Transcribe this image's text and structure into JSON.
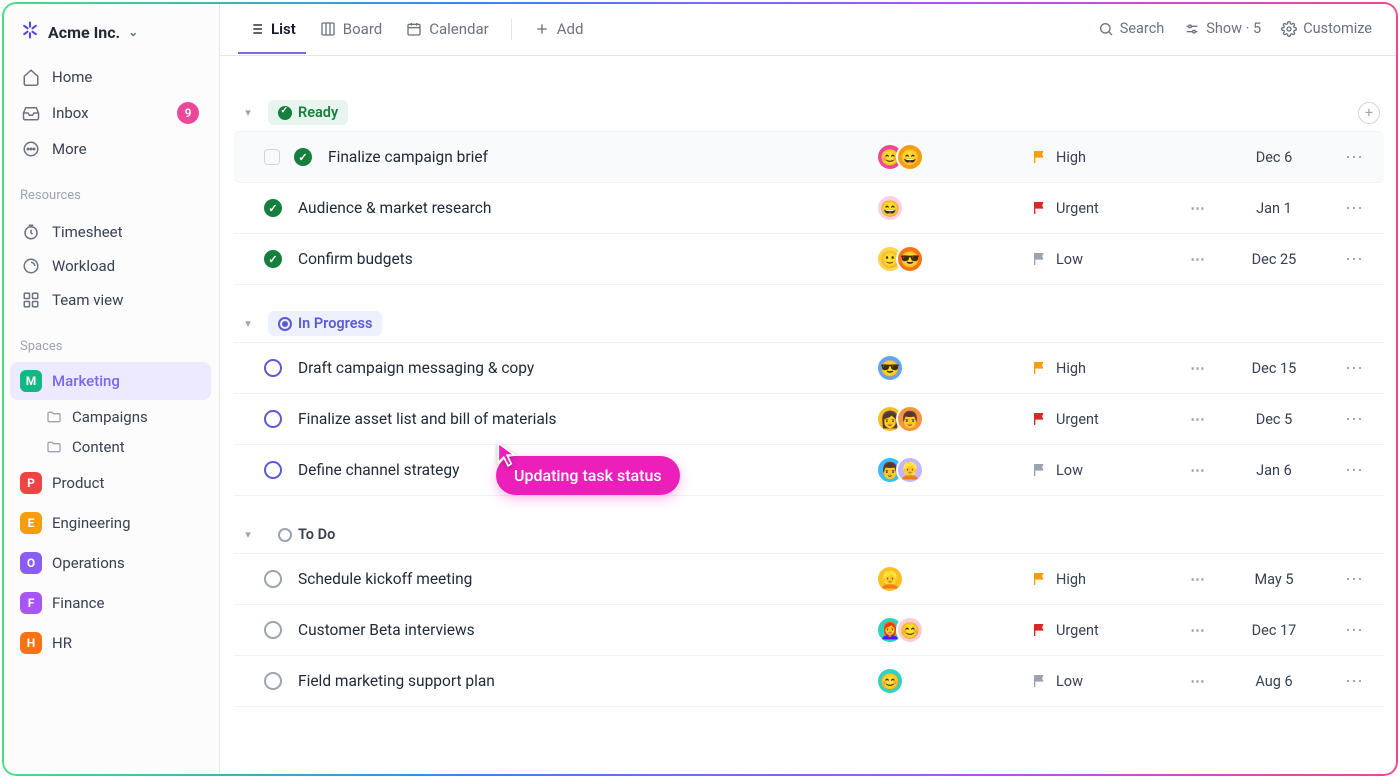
{
  "workspace": {
    "name": "Acme Inc."
  },
  "sidebar": {
    "nav": [
      {
        "label": "Home"
      },
      {
        "label": "Inbox",
        "badge": "9"
      },
      {
        "label": "More"
      }
    ],
    "sections": {
      "resources_label": "Resources",
      "resources": [
        {
          "label": "Timesheet"
        },
        {
          "label": "Workload"
        },
        {
          "label": "Team view"
        }
      ],
      "spaces_label": "Spaces",
      "spaces": [
        {
          "letter": "M",
          "label": "Marketing",
          "color": "#10b981",
          "active": true,
          "children": [
            {
              "label": "Campaigns"
            },
            {
              "label": "Content"
            }
          ]
        },
        {
          "letter": "P",
          "label": "Product",
          "color": "#ef4444"
        },
        {
          "letter": "E",
          "label": "Engineering",
          "color": "#f59e0b"
        },
        {
          "letter": "O",
          "label": "Operations",
          "color": "#8b5cf6"
        },
        {
          "letter": "F",
          "label": "Finance",
          "color": "#a855f7"
        },
        {
          "letter": "H",
          "label": "HR",
          "color": "#f97316"
        }
      ]
    }
  },
  "topbar": {
    "views": [
      {
        "label": "List",
        "active": true
      },
      {
        "label": "Board"
      },
      {
        "label": "Calendar"
      }
    ],
    "add_label": "Add",
    "right": {
      "search": "Search",
      "show": "Show · 5",
      "customize": "Customize"
    }
  },
  "tooltip": "Updating task status",
  "groups": [
    {
      "id": "ready",
      "kind": "ready",
      "label": "Ready",
      "tasks": [
        {
          "name": "Finalize campaign brief",
          "hover": true,
          "checkbox": true,
          "assignees": [
            "#ec4899",
            "#f59e0b"
          ],
          "priority": "High",
          "subtasks": false,
          "date": "Dec 6"
        },
        {
          "name": "Audience & market research",
          "assignees": [
            "#fbcfe8"
          ],
          "priority": "Urgent",
          "subtasks": true,
          "date": "Jan 1"
        },
        {
          "name": "Confirm budgets",
          "assignees": [
            "#fcd34d",
            "#f97316"
          ],
          "priority": "Low",
          "subtasks": true,
          "date": "Dec 25"
        }
      ]
    },
    {
      "id": "progress",
      "kind": "progress",
      "label": "In Progress",
      "tasks": [
        {
          "name": "Draft campaign messaging & copy",
          "assignees": [
            "#60a5fa"
          ],
          "priority": "High",
          "subtasks": true,
          "date": "Dec 15"
        },
        {
          "name": "Finalize asset list and bill of materials",
          "assignees": [
            "#fbbf24",
            "#fb923c"
          ],
          "priority": "Urgent",
          "subtasks": true,
          "date": "Dec 5"
        },
        {
          "name": "Define channel strategy",
          "assignees": [
            "#38bdf8",
            "#c4b5fd"
          ],
          "priority": "Low",
          "subtasks": true,
          "date": "Jan 6"
        }
      ]
    },
    {
      "id": "todo",
      "kind": "todo",
      "label": "To Do",
      "tasks": [
        {
          "name": "Schedule kickoff meeting",
          "assignees": [
            "#fbbf24"
          ],
          "priority": "High",
          "subtasks": true,
          "date": "May 5"
        },
        {
          "name": "Customer Beta interviews",
          "assignees": [
            "#2dd4bf",
            "#fecdd3"
          ],
          "priority": "Urgent",
          "subtasks": true,
          "date": "Dec 17"
        },
        {
          "name": "Field marketing support plan",
          "assignees": [
            "#2dd4bf"
          ],
          "priority": "Low",
          "subtasks": true,
          "date": "Aug 6"
        }
      ]
    }
  ]
}
